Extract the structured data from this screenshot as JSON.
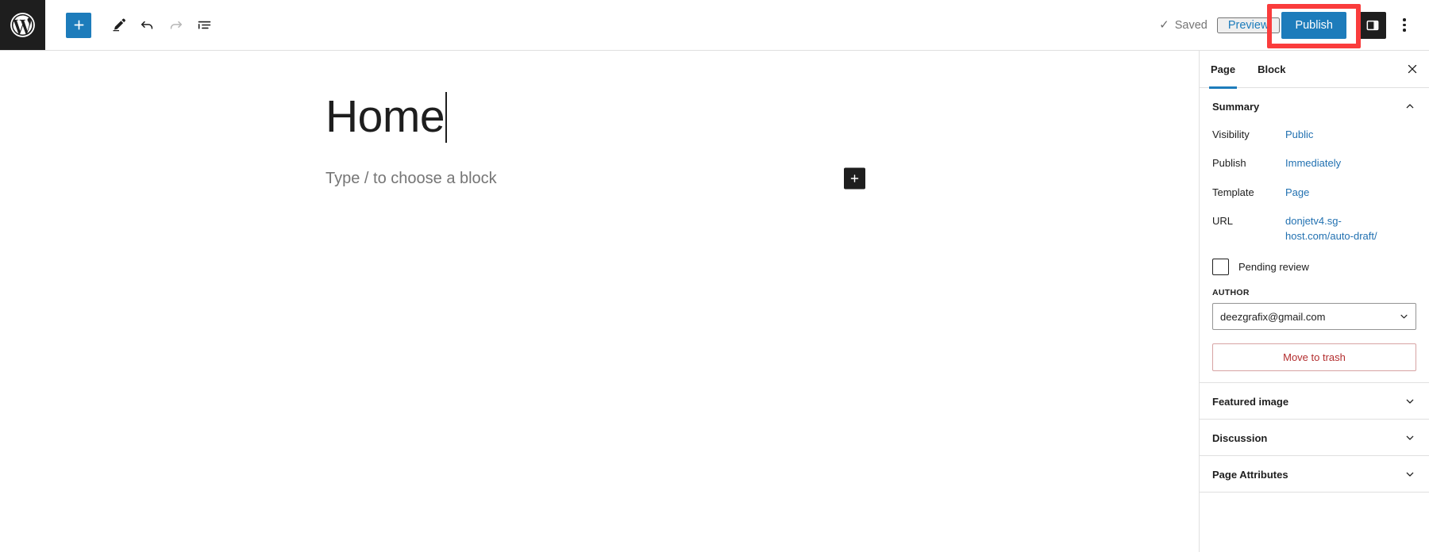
{
  "header": {
    "wp_logo_name": "wordpress-logo",
    "tools": [
      {
        "name": "add-block",
        "label": "Add block",
        "icon": "plus-icon",
        "state": "primary"
      },
      {
        "name": "tools-mode",
        "label": "Tools",
        "icon": "pencil-icon",
        "state": "default"
      },
      {
        "name": "undo",
        "label": "Undo",
        "icon": "undo-icon",
        "state": "default"
      },
      {
        "name": "redo",
        "label": "Redo",
        "icon": "redo-icon",
        "state": "disabled"
      },
      {
        "name": "list-view",
        "label": "Document Overview",
        "icon": "list-view-icon",
        "state": "default"
      }
    ],
    "saved_label": "Saved",
    "saved_check": "✓",
    "preview_label": "Preview",
    "publish_label": "Publish",
    "publish_highlighted": true,
    "sidebar_toggle_label": "Settings",
    "options_label": "Options"
  },
  "editor": {
    "title": "Home",
    "block_placeholder": "Type / to choose a block",
    "inserter_label": "Add block"
  },
  "settings": {
    "tabs": [
      {
        "label": "Page",
        "active": true
      },
      {
        "label": "Block",
        "active": false
      }
    ],
    "close_label": "Close settings",
    "panels": [
      {
        "title": "Summary",
        "expanded": true
      },
      {
        "title": "Featured image",
        "expanded": false
      },
      {
        "title": "Discussion",
        "expanded": false
      },
      {
        "title": "Page Attributes",
        "expanded": false
      }
    ],
    "summary_rows": [
      {
        "label": "Visibility",
        "value": "Public"
      },
      {
        "label": "Publish",
        "value": "Immediately"
      },
      {
        "label": "Template",
        "value": "Page"
      },
      {
        "label": "URL",
        "value": "donjetv4.sg-host.com/auto-draft/"
      }
    ],
    "pending_review_label": "Pending review",
    "pending_review_checked": false,
    "author_label": "AUTHOR",
    "author_value": "deezgrafix@gmail.com",
    "author_options": [
      "deezgrafix@gmail.com"
    ],
    "trash_label": "Move to trash"
  },
  "colors": {
    "accent_blue": "#1d7cbb",
    "link_blue": "#2271b1",
    "highlight_red": "#fa3c3c",
    "trash_red": "#b32d2e",
    "dark": "#1e1e1e",
    "muted": "#757575",
    "border": "#e0e0e0"
  }
}
